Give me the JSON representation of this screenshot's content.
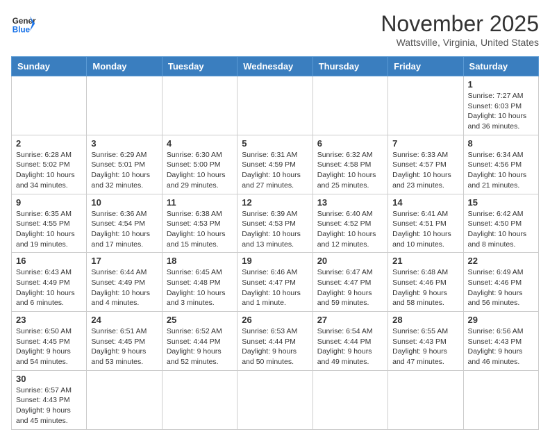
{
  "header": {
    "logo_general": "General",
    "logo_blue": "Blue",
    "month": "November 2025",
    "location": "Wattsville, Virginia, United States"
  },
  "days_of_week": [
    "Sunday",
    "Monday",
    "Tuesday",
    "Wednesday",
    "Thursday",
    "Friday",
    "Saturday"
  ],
  "weeks": [
    [
      null,
      null,
      null,
      null,
      null,
      null,
      {
        "date": "1",
        "sunrise": "7:27 AM",
        "sunset": "6:03 PM",
        "daylight": "10 hours and 36 minutes."
      }
    ],
    [
      {
        "date": "2",
        "sunrise": "6:28 AM",
        "sunset": "5:02 PM",
        "daylight": "10 hours and 34 minutes."
      },
      {
        "date": "3",
        "sunrise": "6:29 AM",
        "sunset": "5:01 PM",
        "daylight": "10 hours and 32 minutes."
      },
      {
        "date": "4",
        "sunrise": "6:30 AM",
        "sunset": "5:00 PM",
        "daylight": "10 hours and 29 minutes."
      },
      {
        "date": "5",
        "sunrise": "6:31 AM",
        "sunset": "4:59 PM",
        "daylight": "10 hours and 27 minutes."
      },
      {
        "date": "6",
        "sunrise": "6:32 AM",
        "sunset": "4:58 PM",
        "daylight": "10 hours and 25 minutes."
      },
      {
        "date": "7",
        "sunrise": "6:33 AM",
        "sunset": "4:57 PM",
        "daylight": "10 hours and 23 minutes."
      },
      {
        "date": "8",
        "sunrise": "6:34 AM",
        "sunset": "4:56 PM",
        "daylight": "10 hours and 21 minutes."
      }
    ],
    [
      {
        "date": "9",
        "sunrise": "6:35 AM",
        "sunset": "4:55 PM",
        "daylight": "10 hours and 19 minutes."
      },
      {
        "date": "10",
        "sunrise": "6:36 AM",
        "sunset": "4:54 PM",
        "daylight": "10 hours and 17 minutes."
      },
      {
        "date": "11",
        "sunrise": "6:38 AM",
        "sunset": "4:53 PM",
        "daylight": "10 hours and 15 minutes."
      },
      {
        "date": "12",
        "sunrise": "6:39 AM",
        "sunset": "4:53 PM",
        "daylight": "10 hours and 13 minutes."
      },
      {
        "date": "13",
        "sunrise": "6:40 AM",
        "sunset": "4:52 PM",
        "daylight": "10 hours and 12 minutes."
      },
      {
        "date": "14",
        "sunrise": "6:41 AM",
        "sunset": "4:51 PM",
        "daylight": "10 hours and 10 minutes."
      },
      {
        "date": "15",
        "sunrise": "6:42 AM",
        "sunset": "4:50 PM",
        "daylight": "10 hours and 8 minutes."
      }
    ],
    [
      {
        "date": "16",
        "sunrise": "6:43 AM",
        "sunset": "4:49 PM",
        "daylight": "10 hours and 6 minutes."
      },
      {
        "date": "17",
        "sunrise": "6:44 AM",
        "sunset": "4:49 PM",
        "daylight": "10 hours and 4 minutes."
      },
      {
        "date": "18",
        "sunrise": "6:45 AM",
        "sunset": "4:48 PM",
        "daylight": "10 hours and 3 minutes."
      },
      {
        "date": "19",
        "sunrise": "6:46 AM",
        "sunset": "4:47 PM",
        "daylight": "10 hours and 1 minute."
      },
      {
        "date": "20",
        "sunrise": "6:47 AM",
        "sunset": "4:47 PM",
        "daylight": "9 hours and 59 minutes."
      },
      {
        "date": "21",
        "sunrise": "6:48 AM",
        "sunset": "4:46 PM",
        "daylight": "9 hours and 58 minutes."
      },
      {
        "date": "22",
        "sunrise": "6:49 AM",
        "sunset": "4:46 PM",
        "daylight": "9 hours and 56 minutes."
      }
    ],
    [
      {
        "date": "23",
        "sunrise": "6:50 AM",
        "sunset": "4:45 PM",
        "daylight": "9 hours and 54 minutes."
      },
      {
        "date": "24",
        "sunrise": "6:51 AM",
        "sunset": "4:45 PM",
        "daylight": "9 hours and 53 minutes."
      },
      {
        "date": "25",
        "sunrise": "6:52 AM",
        "sunset": "4:44 PM",
        "daylight": "9 hours and 52 minutes."
      },
      {
        "date": "26",
        "sunrise": "6:53 AM",
        "sunset": "4:44 PM",
        "daylight": "9 hours and 50 minutes."
      },
      {
        "date": "27",
        "sunrise": "6:54 AM",
        "sunset": "4:44 PM",
        "daylight": "9 hours and 49 minutes."
      },
      {
        "date": "28",
        "sunrise": "6:55 AM",
        "sunset": "4:43 PM",
        "daylight": "9 hours and 47 minutes."
      },
      {
        "date": "29",
        "sunrise": "6:56 AM",
        "sunset": "4:43 PM",
        "daylight": "9 hours and 46 minutes."
      }
    ],
    [
      {
        "date": "30",
        "sunrise": "6:57 AM",
        "sunset": "4:43 PM",
        "daylight": "9 hours and 45 minutes."
      },
      null,
      null,
      null,
      null,
      null,
      null
    ]
  ]
}
